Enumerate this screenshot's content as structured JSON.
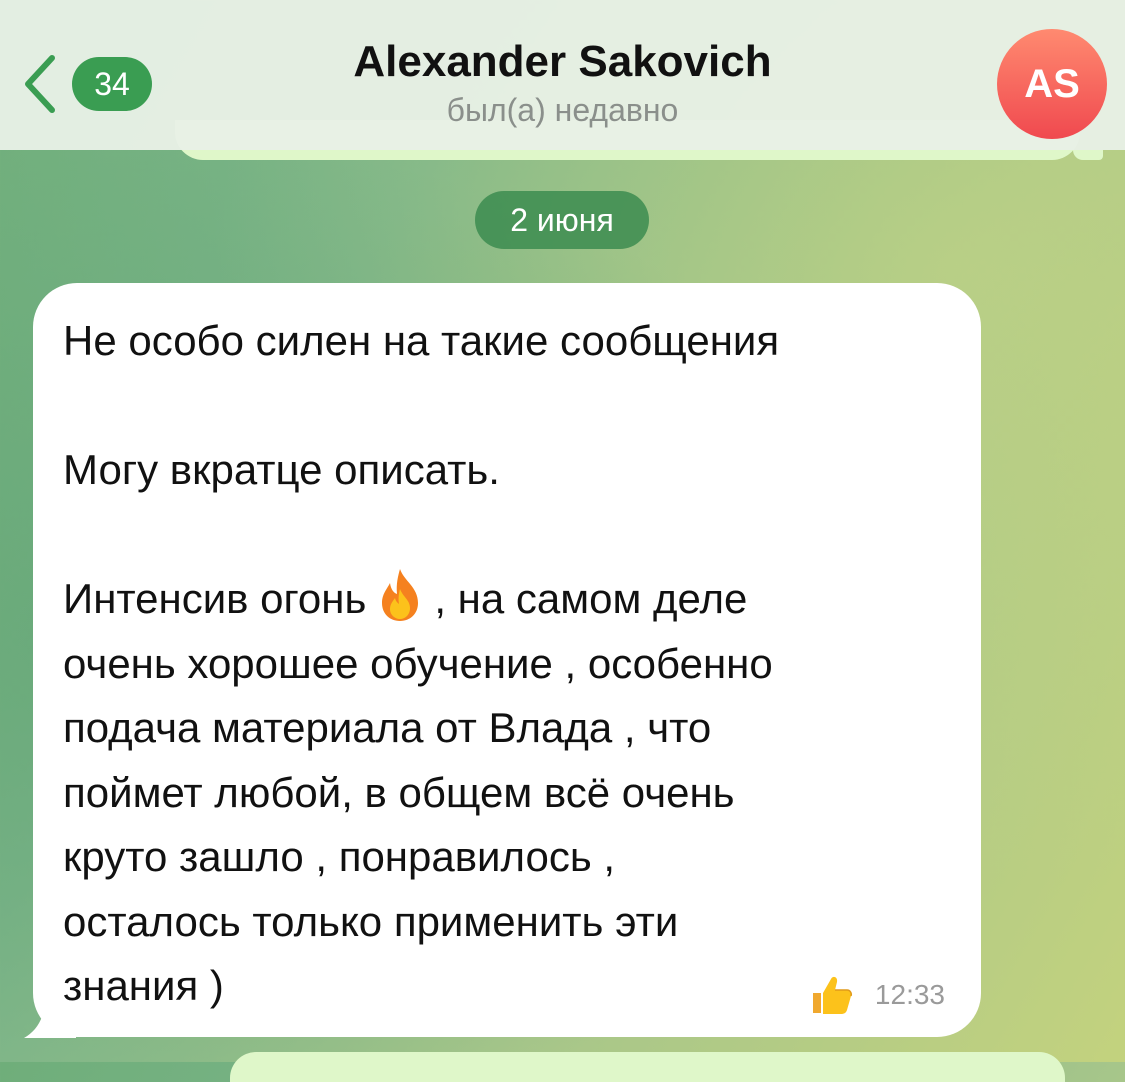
{
  "header": {
    "back_label": "Back",
    "unread_count": "34",
    "contact_name": "Alexander Sakovich",
    "status": "был(а) недавно",
    "avatar_initials": "AS",
    "avatar_colors": [
      "#ff8a70",
      "#f0494f"
    ]
  },
  "chat": {
    "date_separator": "2 июня",
    "message": {
      "lines_before_icon": "Не особо силен на такие сообщения\n\nМогу вкратце описать.\n\nИнтенсив огонь",
      "icon": "fire-emoji-icon",
      "lines_after_icon": ", на самом деле\nочень хорошее обучение , особенно\nподача материала от Влада , что\nпоймет любой, в общем всё очень\nкруто зашло , понравилось ,\nосталось только применить эти\nзнания )",
      "reaction_icon": "thumbs-up-icon",
      "time": "12:33"
    }
  },
  "colors": {
    "accent_green": "#3a9d52",
    "outgoing_bubble": "#dff7c9",
    "incoming_bubble": "#ffffff"
  }
}
